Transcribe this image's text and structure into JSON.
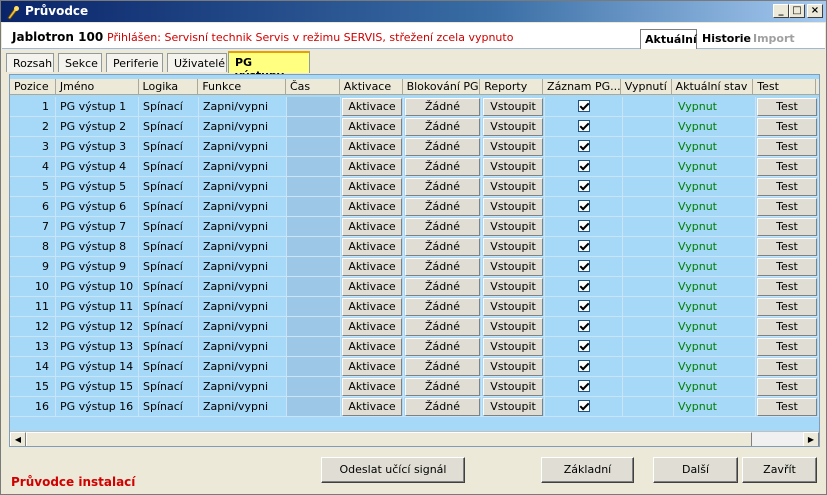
{
  "window": {
    "title": "Průvodce"
  },
  "header": {
    "app_name": "Jablotron 100",
    "login_info": "Přihlášen: Servisní technik Servis v režimu SERVIS, střežení zcela vypnuto",
    "view_tabs": [
      "Aktuální",
      "Historie",
      "Import"
    ]
  },
  "tabs": [
    "Rozsah",
    "Sekce",
    "Periferie",
    "Uživatelé",
    "PG výstupy"
  ],
  "grid": {
    "columns": [
      "Pozice",
      "Jméno",
      "Logika",
      "Funkce",
      "Čas",
      "Aktivace",
      "Blokování PG",
      "Reporty",
      "Záznam PG...",
      "Vypnutí",
      "Aktuální stav",
      "Test"
    ],
    "rows": [
      {
        "pos": "1",
        "name": "PG výstup 1",
        "logic": "Spínací",
        "func": "Zapni/vypni",
        "akt": "Aktivace",
        "blk": "Žádné",
        "rep": "Vstoupit",
        "zaz": true,
        "stav": "Vypnut",
        "test": "Test"
      },
      {
        "pos": "2",
        "name": "PG výstup 2",
        "logic": "Spínací",
        "func": "Zapni/vypni",
        "akt": "Aktivace",
        "blk": "Žádné",
        "rep": "Vstoupit",
        "zaz": true,
        "stav": "Vypnut",
        "test": "Test"
      },
      {
        "pos": "3",
        "name": "PG výstup 3",
        "logic": "Spínací",
        "func": "Zapni/vypni",
        "akt": "Aktivace",
        "blk": "Žádné",
        "rep": "Vstoupit",
        "zaz": true,
        "stav": "Vypnut",
        "test": "Test"
      },
      {
        "pos": "4",
        "name": "PG výstup 4",
        "logic": "Spínací",
        "func": "Zapni/vypni",
        "akt": "Aktivace",
        "blk": "Žádné",
        "rep": "Vstoupit",
        "zaz": true,
        "stav": "Vypnut",
        "test": "Test"
      },
      {
        "pos": "5",
        "name": "PG výstup 5",
        "logic": "Spínací",
        "func": "Zapni/vypni",
        "akt": "Aktivace",
        "blk": "Žádné",
        "rep": "Vstoupit",
        "zaz": true,
        "stav": "Vypnut",
        "test": "Test"
      },
      {
        "pos": "6",
        "name": "PG výstup 6",
        "logic": "Spínací",
        "func": "Zapni/vypni",
        "akt": "Aktivace",
        "blk": "Žádné",
        "rep": "Vstoupit",
        "zaz": true,
        "stav": "Vypnut",
        "test": "Test"
      },
      {
        "pos": "7",
        "name": "PG výstup 7",
        "logic": "Spínací",
        "func": "Zapni/vypni",
        "akt": "Aktivace",
        "blk": "Žádné",
        "rep": "Vstoupit",
        "zaz": true,
        "stav": "Vypnut",
        "test": "Test"
      },
      {
        "pos": "8",
        "name": "PG výstup 8",
        "logic": "Spínací",
        "func": "Zapni/vypni",
        "akt": "Aktivace",
        "blk": "Žádné",
        "rep": "Vstoupit",
        "zaz": true,
        "stav": "Vypnut",
        "test": "Test"
      },
      {
        "pos": "9",
        "name": "PG výstup 9",
        "logic": "Spínací",
        "func": "Zapni/vypni",
        "akt": "Aktivace",
        "blk": "Žádné",
        "rep": "Vstoupit",
        "zaz": true,
        "stav": "Vypnut",
        "test": "Test"
      },
      {
        "pos": "10",
        "name": "PG výstup 10",
        "logic": "Spínací",
        "func": "Zapni/vypni",
        "akt": "Aktivace",
        "blk": "Žádné",
        "rep": "Vstoupit",
        "zaz": true,
        "stav": "Vypnut",
        "test": "Test"
      },
      {
        "pos": "11",
        "name": "PG výstup 11",
        "logic": "Spínací",
        "func": "Zapni/vypni",
        "akt": "Aktivace",
        "blk": "Žádné",
        "rep": "Vstoupit",
        "zaz": true,
        "stav": "Vypnut",
        "test": "Test"
      },
      {
        "pos": "12",
        "name": "PG výstup 12",
        "logic": "Spínací",
        "func": "Zapni/vypni",
        "akt": "Aktivace",
        "blk": "Žádné",
        "rep": "Vstoupit",
        "zaz": true,
        "stav": "Vypnut",
        "test": "Test"
      },
      {
        "pos": "13",
        "name": "PG výstup 13",
        "logic": "Spínací",
        "func": "Zapni/vypni",
        "akt": "Aktivace",
        "blk": "Žádné",
        "rep": "Vstoupit",
        "zaz": true,
        "stav": "Vypnut",
        "test": "Test"
      },
      {
        "pos": "14",
        "name": "PG výstup 14",
        "logic": "Spínací",
        "func": "Zapni/vypni",
        "akt": "Aktivace",
        "blk": "Žádné",
        "rep": "Vstoupit",
        "zaz": true,
        "stav": "Vypnut",
        "test": "Test"
      },
      {
        "pos": "15",
        "name": "PG výstup 15",
        "logic": "Spínací",
        "func": "Zapni/vypni",
        "akt": "Aktivace",
        "blk": "Žádné",
        "rep": "Vstoupit",
        "zaz": true,
        "stav": "Vypnut",
        "test": "Test"
      },
      {
        "pos": "16",
        "name": "PG výstup 16",
        "logic": "Spínací",
        "func": "Zapni/vypni",
        "akt": "Aktivace",
        "blk": "Žádné",
        "rep": "Vstoupit",
        "zaz": true,
        "stav": "Vypnut",
        "test": "Test"
      }
    ]
  },
  "footer": {
    "title": "Průvodce instalací",
    "send_label": "Odeslat učící signál",
    "basic_label": "Základní",
    "next_label": "Další",
    "close_label": "Zavřít"
  },
  "colors": {
    "status_off": "#008000",
    "login_info": "#d00000",
    "grid_bg": "#a6d8f8",
    "active_tab": "#ffff80"
  }
}
